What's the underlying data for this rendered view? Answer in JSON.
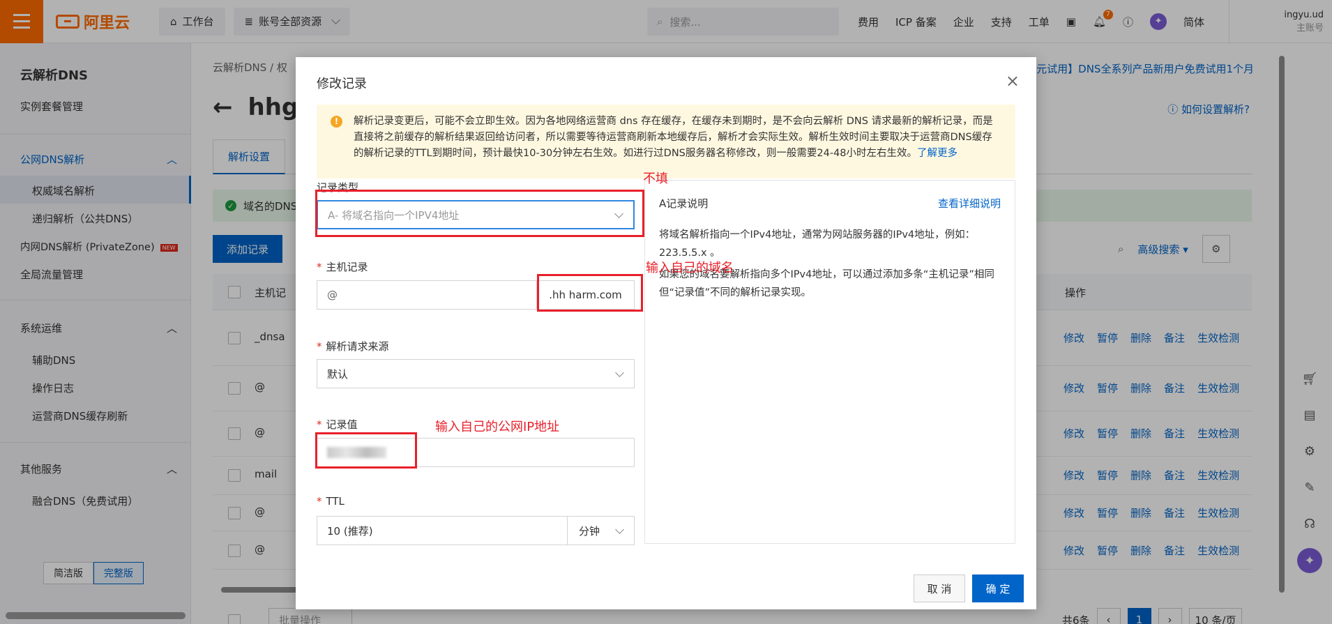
{
  "topbar": {
    "brand": "阿里云",
    "workbench": "工作台",
    "resources": "账号全部资源",
    "search_placeholder": "搜索...",
    "links": [
      "费用",
      "ICP 备案",
      "企业",
      "支持",
      "工单"
    ],
    "notification_count": "7",
    "language": "简体",
    "account_name": "ingyu.ud",
    "account_role": "主账号",
    "accent_color": "#ff6a00"
  },
  "sidebar": {
    "title": "云解析DNS",
    "package": "实例套餐管理",
    "group_public": "公网DNS解析",
    "authoritative": "权威域名解析",
    "recursive": "递归解析（公共DNS）",
    "private_zone": "内网DNS解析 (PrivateZone)",
    "new_badge": "NEW",
    "global_traffic": "全局流量管理",
    "group_ops": "系统运维",
    "aux_dns": "辅助DNS",
    "op_log": "操作日志",
    "isp_refresh": "运营商DNS缓存刷新",
    "group_other": "其他服务",
    "fusion_dns": "融合DNS（免费试用）",
    "simple_version": "简洁版",
    "full_version": "完整版"
  },
  "main": {
    "breadcrumb": "云解析DNS / 权",
    "promo": "0元试用】DNS全系列产品新用户免费试用1个月",
    "title": "hhg",
    "help": "如何设置解析?",
    "tab": "解析设置",
    "success_text": "域名的DNS",
    "add_record": "添加记录",
    "advanced_search": "高级搜索",
    "col_host": "主机记",
    "col_actions": "操作",
    "rows": [
      {
        "host": "_dnsa"
      },
      {
        "host": "@"
      },
      {
        "host": "@"
      },
      {
        "host": "mail"
      },
      {
        "host": "@"
      },
      {
        "host": "@"
      }
    ],
    "row_actions": [
      "修改",
      "暂停",
      "删除",
      "备注",
      "生效检测"
    ],
    "batch": "批量操作",
    "total": "共6条",
    "page": "1",
    "page_size": "10 条/页"
  },
  "modal": {
    "title": "修改记录",
    "notice": "解析记录变更后，可能不会立即生效。因为各地网络运营商 dns 存在缓存，在缓存未到期时，是不会向云解析 DNS 请求最新的解析记录，而是直接将之前缓存的解析结果返回给访问者，所以需要等待运营商刷新本地缓存后，解析才会实际生效。解析生效时间主要取决于运营商DNS缓存的解析记录的TTL到期时间，预计最快10-30分钟左右生效。如进行过DNS服务器名称修改，则一般需要24-48小时左右生效。",
    "notice_link": "了解更多",
    "record_type_label": "记录类型",
    "record_type_value": "A- 将域名指向一个IPV4地址",
    "host_label": "主机记录",
    "host_value": "@",
    "host_suffix": ".hh harm.com",
    "source_label": "解析请求来源",
    "source_value": "默认",
    "value_label": "记录值",
    "ttl_label": "TTL",
    "ttl_value": "10 (推荐)",
    "ttl_unit": "分钟",
    "info_title": "A记录说明",
    "info_link": "查看详细说明",
    "info_p1": "将域名解析指向一个IPv4地址，通常为网站服务器的IPv4地址，例如：223.5.5.x 。",
    "info_p2": "如果您的域名要解析指向多个IPv4地址，可以通过添加多条“主机记录”相同但“记录值”不同的解析记录实现。",
    "cancel": "取 消",
    "confirm": "确 定"
  },
  "annotations": {
    "no_fill": "不填",
    "enter_domain": "输入自己的域名",
    "enter_ip": "输入自己的公网IP地址"
  }
}
